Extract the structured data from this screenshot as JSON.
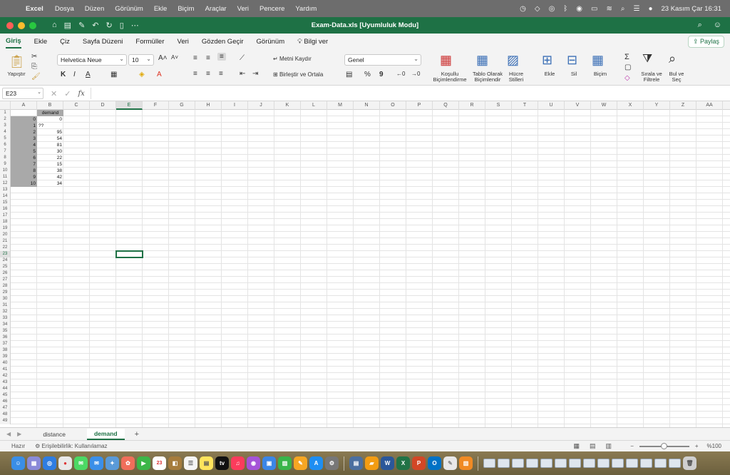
{
  "menubar": {
    "app_name": "Excel",
    "items": [
      "Dosya",
      "Düzen",
      "Görünüm",
      "Ekle",
      "Biçim",
      "Araçlar",
      "Veri",
      "Pencere",
      "Yardım"
    ],
    "clock": "23 Kasım Çar  16:31"
  },
  "titlebar": {
    "title": "Exam-Data.xls  [Uyumluluk Modu]"
  },
  "ribbon_tabs": {
    "tabs": [
      "Giriş",
      "Ekle",
      "Çiz",
      "Sayfa Düzeni",
      "Formüller",
      "Veri",
      "Gözden Geçir",
      "Görünüm"
    ],
    "tell_me": "Bilgi ver",
    "share": "Paylaş"
  },
  "ribbon": {
    "paste": "Yapıştır",
    "font_name": "Helvetica Neue",
    "font_size": "10",
    "bold": "K",
    "italic": "I",
    "underline": "A",
    "wrap_text": "Metni Kaydır",
    "merge_center": "Birleştir ve Ortala",
    "number_format": "Genel",
    "percent": "%",
    "comma": "9",
    "cond_format": [
      "Koşullu",
      "Biçimlendirme"
    ],
    "format_table": [
      "Tablo Olarak",
      "Biçimlendir"
    ],
    "cell_styles": [
      "Hücre",
      "Stilleri"
    ],
    "insert": "Ekle",
    "delete": "Sil",
    "format": "Biçim",
    "sort_filter": [
      "Sırala ve",
      "Filtrele"
    ],
    "find_select": [
      "Bul ve",
      "Seç"
    ]
  },
  "formula_bar": {
    "name_box": "E23",
    "fx": "fx",
    "content": ""
  },
  "columns": [
    "A",
    "B",
    "C",
    "D",
    "E",
    "F",
    "G",
    "H",
    "I",
    "J",
    "K",
    "L",
    "M",
    "N",
    "O",
    "P",
    "Q",
    "R",
    "S",
    "T",
    "U",
    "V",
    "W",
    "X",
    "Y",
    "Z",
    "AA"
  ],
  "selected_column": "E",
  "selected_row": "23",
  "rows": [
    "1",
    "2",
    "3",
    "4",
    "5",
    "6",
    "7",
    "8",
    "9",
    "10",
    "11",
    "12",
    "13",
    "14",
    "15",
    "16",
    "17",
    "18",
    "19",
    "20",
    "21",
    "22",
    "23",
    "24",
    "25",
    "26",
    "27",
    "28",
    "29",
    "30",
    "31",
    "32",
    "33",
    "34",
    "35",
    "36",
    "37",
    "38",
    "39",
    "40",
    "41",
    "42",
    "43",
    "44",
    "45",
    "46",
    "47",
    "48",
    "49"
  ],
  "sheet_cells": {
    "B1": "demand",
    "A2": "0",
    "B2": "0",
    "A3": "1",
    "B3": "??",
    "A4": "2",
    "B4": "95",
    "A5": "3",
    "B5": "54",
    "A6": "4",
    "B6": "81",
    "A7": "5",
    "B7": "30",
    "A8": "6",
    "B8": "22",
    "A9": "7",
    "B9": "15",
    "A10": "8",
    "B10": "38",
    "A11": "9",
    "B11": "42",
    "A12": "10",
    "B12": "34"
  },
  "sheet_tabs": [
    "distance",
    "demand"
  ],
  "active_sheet": "demand",
  "statusbar": {
    "ready": "Hazır",
    "accessibility": "Erişilebilirlik: Kullanılamaz",
    "zoom": "%100"
  },
  "dock": {
    "calendar_day": "23"
  }
}
